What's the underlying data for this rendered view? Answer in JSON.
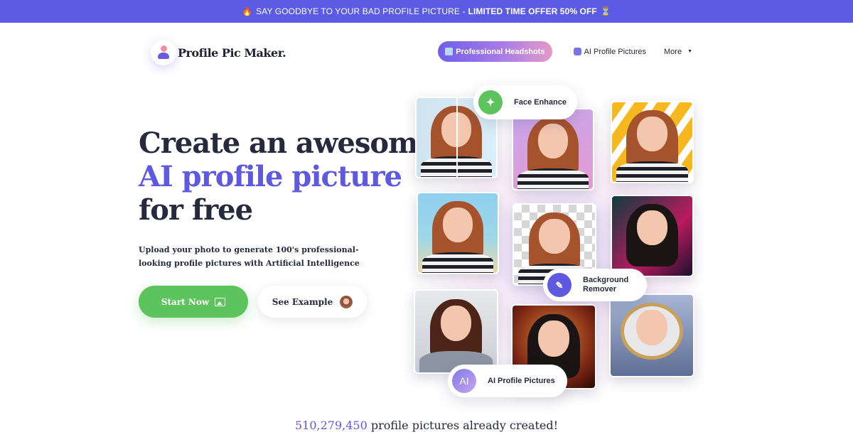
{
  "banner": {
    "fire_icon": "🔥",
    "text": "SAY GOODBYE TO YOUR BAD PROFILE PICTURE - ",
    "offer": "LIMITED TIME OFFER 50% OFF",
    "hourglass_icon": "⏳",
    "background_color": "#5b5be6"
  },
  "header": {
    "logo_text": "Profile Pic Maker.",
    "nav": {
      "headshots": "Professional Headshots",
      "ai_pictures": "AI Profile Pictures",
      "more": "More",
      "more_caret": "▼"
    }
  },
  "hero": {
    "title_line1": "Create an awesome",
    "title_line2": "AI profile picture",
    "title_line3": "for free",
    "subtitle": "Upload your photo to generate 100's professional-looking profile pictures with Artificial Intelligence",
    "start_button": "Start Now",
    "example_button": "See Example",
    "accent_color": "#5f58e0",
    "cta_color": "#5dc35d"
  },
  "badges": {
    "face_enhance": "Face Enhance",
    "face_enhance_icon": "✦",
    "background_remover": "Background Remover",
    "background_remover_icon": "✎",
    "ai_profile_pictures": "AI Profile Pictures",
    "ai_icon_text": "AI"
  },
  "footer_stat": {
    "count": "510,279,450",
    "text": " profile pictures already created!"
  }
}
